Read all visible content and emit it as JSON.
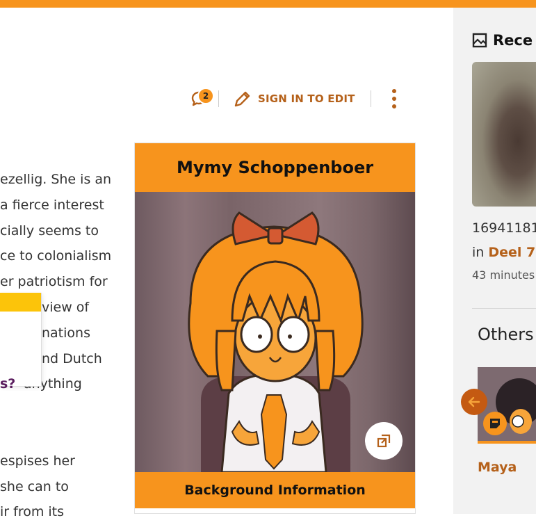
{
  "toolbar": {
    "comment_count": "2",
    "edit_label": "SIGN IN TO EDIT"
  },
  "article": {
    "lines": [
      "ezellig. She is an",
      "a fierce interest",
      "cially seems to",
      "ce to colonialism",
      "er patriotism for",
      "view of",
      "nations",
      "nd Dutch",
      "anything",
      "",
      "",
      "espises her",
      "she can to",
      "ir from its"
    ],
    "question_mark": "s?"
  },
  "infobox": {
    "title": "Mymy Schoppenboer",
    "section_header": "Background Information"
  },
  "rail": {
    "heading": "Rece",
    "image_id": "16941181",
    "in_prefix": "in ",
    "in_link": "Deel 7",
    "time": "43 minutes",
    "others_heading": "Others",
    "card_label": "Maya"
  },
  "colors": {
    "brand_orange": "#f7941d",
    "link_brown": "#b5611a",
    "tooltip_yellow": "#fcc40a"
  }
}
